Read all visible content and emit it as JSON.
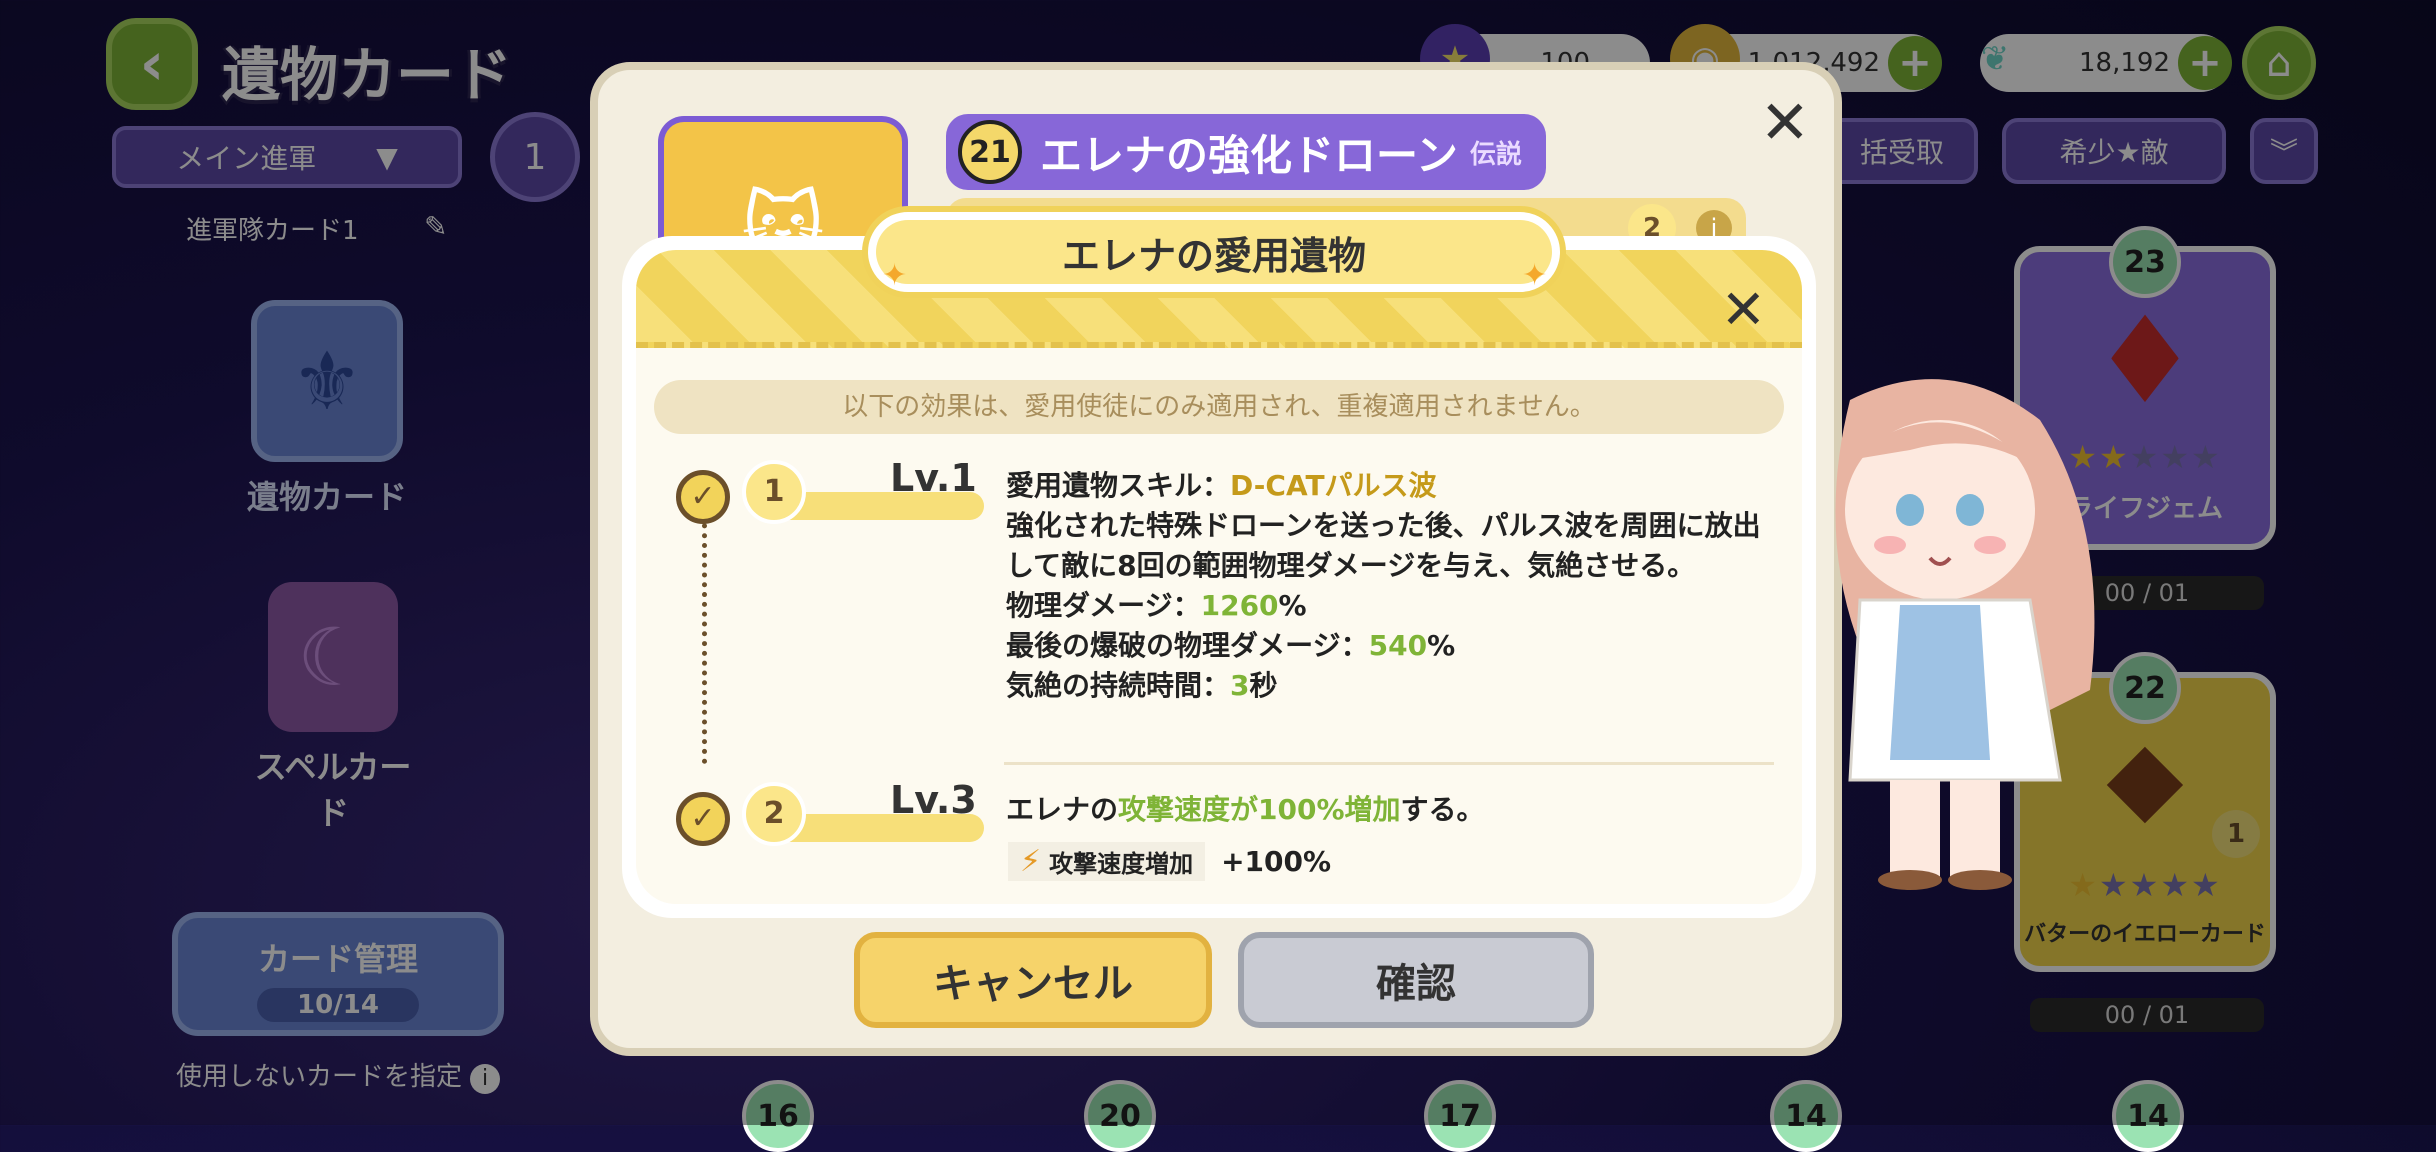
{
  "topbar": {
    "title": "遺物カード",
    "currencies": [
      {
        "icon": "star-gem-icon",
        "value": "100"
      },
      {
        "icon": "gold-coin-icon",
        "value": "1,012,492"
      },
      {
        "icon": "butterfly-icon",
        "value": "18,192"
      }
    ]
  },
  "left": {
    "squad_select": "メイン進軍",
    "squad_number": "1",
    "deck_name": "進軍隊カード1",
    "tabs": [
      "遺物カード",
      "スペルカード"
    ],
    "manage_label": "カード管理",
    "manage_count": "10/14",
    "unused_label": "使用しないカードを指定"
  },
  "right": {
    "bulk_label": "括受取",
    "rare_label": "希少★敵",
    "cards": [
      {
        "level": "23",
        "name": "ライフジェム",
        "stars": 2,
        "count": "00 / 01"
      },
      {
        "level": "22",
        "name": "バターのイエローカード",
        "stars": 1,
        "count": "00 / 01",
        "badge": "1"
      }
    ],
    "bottom_levels": [
      "16",
      "20",
      "17",
      "14",
      "14"
    ]
  },
  "back_dialog": {
    "relic_level": "21",
    "relic_name": "エレナの強化ドローン",
    "relic_rarity": "伝説",
    "strip_label": "エレナの愛用",
    "strip_count": "2",
    "cancel": "キャンセル",
    "confirm": "確認"
  },
  "dialog": {
    "title": "エレナの愛用遺物",
    "notice": "以下の効果は、愛用使徒にのみ適用され、重複適用されません。",
    "steps": [
      {
        "num": "1",
        "lv": "Lv.1"
      },
      {
        "num": "2",
        "lv": "Lv.3"
      }
    ],
    "skill_prefix": "愛用遺物スキル：",
    "skill_name": "D-CATパルス波",
    "skill_desc": "強化された特殊ドローンを送った後、パルス波を周囲に放出して敵に8回の範囲物理ダメージを与え、気絶させる。",
    "stat1_label": "物理ダメージ：",
    "stat1_value": "1260",
    "stat1_unit": "%",
    "stat2_label": "最後の爆破の物理ダメージ：",
    "stat2_value": "540",
    "stat2_unit": "%",
    "stat3_label": "気絶の持続時間：",
    "stat3_value": "3",
    "stat3_unit": "秒",
    "lv3_prefix": "エレナの",
    "lv3_highlight": "攻撃速度が100%増加",
    "lv3_suffix": "する。",
    "buff_label": "攻撃速度増加",
    "buff_value": "+100%"
  }
}
